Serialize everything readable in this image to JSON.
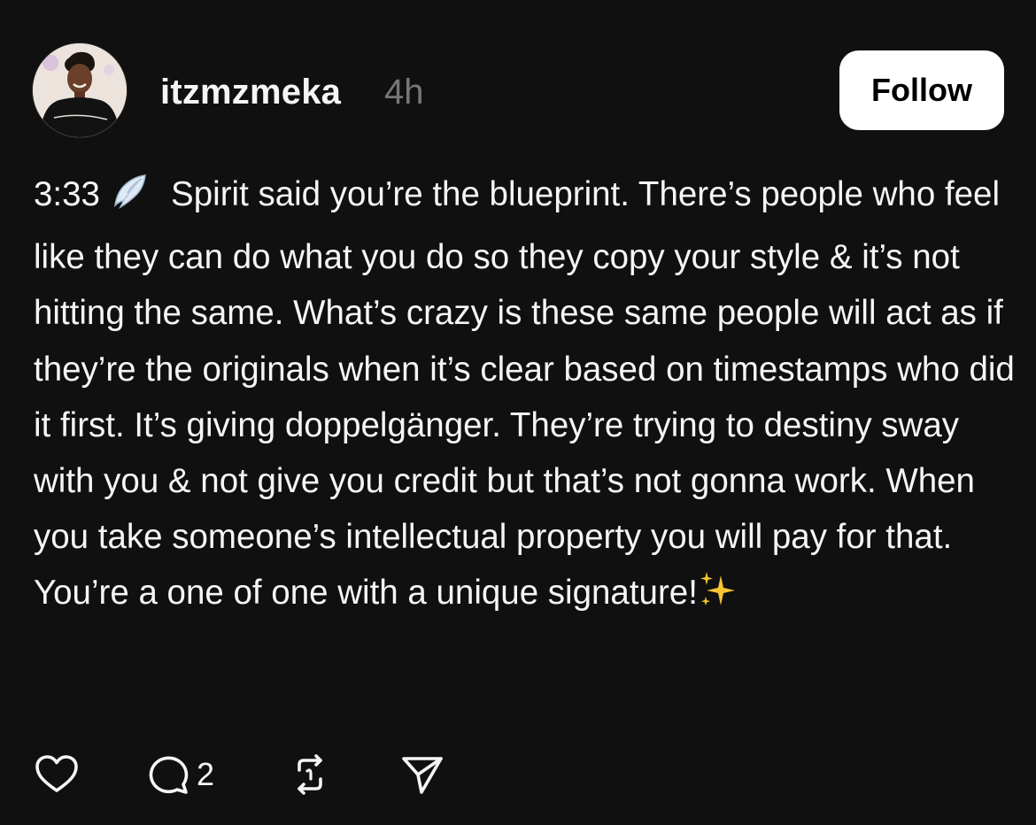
{
  "post": {
    "author": {
      "username": "itzmzmeka",
      "timestamp": "4h",
      "avatar": "profile-photo"
    },
    "follow_label": "Follow",
    "text": {
      "lead": "3:33",
      "lead_emoji": "angel-wing-icon",
      "body": "Spirit said you’re the blueprint. There’s people who feel like they can do what you do so they copy your style & it’s not hitting the same. What’s crazy is these same people will act as if they’re the originals when it’s clear based on timestamps who did it first. It’s giving doppelgänger. They’re trying to destiny sway with you & not give you credit but that’s not gonna work. When you take someone’s intellectual property you will pay for that. You’re a one of one with a unique signature!",
      "trail_emoji": "sparkles-icon"
    },
    "actions": {
      "like_icon": "heart-icon",
      "reply_icon": "comment-icon",
      "reply_count": "2",
      "repost_icon": "repost-icon",
      "share_icon": "send-icon"
    }
  },
  "colors": {
    "background": "#101010",
    "text": "#f3f5f7",
    "muted": "#777777",
    "follow_bg": "#ffffff",
    "follow_text": "#000000"
  }
}
